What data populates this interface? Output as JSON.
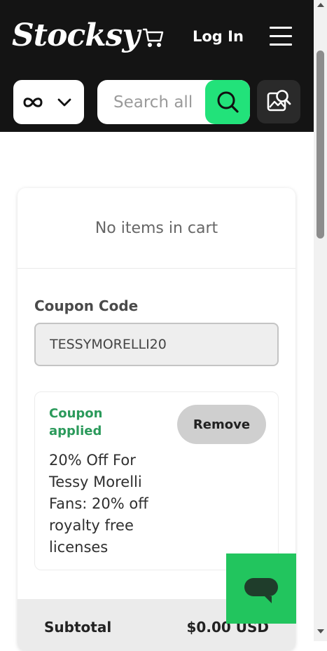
{
  "header": {
    "logo_text": "Stocksy",
    "login_label": "Log In",
    "search_placeholder": "Search all",
    "accent_color": "#22e27a",
    "icons": [
      "infinity-icon",
      "chevron-down-icon",
      "cart-icon",
      "menu-icon",
      "search-icon",
      "image-search-icon"
    ]
  },
  "cart": {
    "empty_text": "No items in cart",
    "coupon_label": "Coupon Code",
    "coupon_value": "TESSYMORELLI20",
    "coupon_status": "Coupon applied",
    "coupon_description": "20% Off For Tessy Morelli Fans: 20% off royalty free licenses",
    "remove_label": "Remove",
    "subtotal_label": "Subtotal",
    "subtotal_value": "$0.00 USD"
  },
  "chat": {
    "icon": "chat-icon",
    "color": "#22c55e"
  }
}
